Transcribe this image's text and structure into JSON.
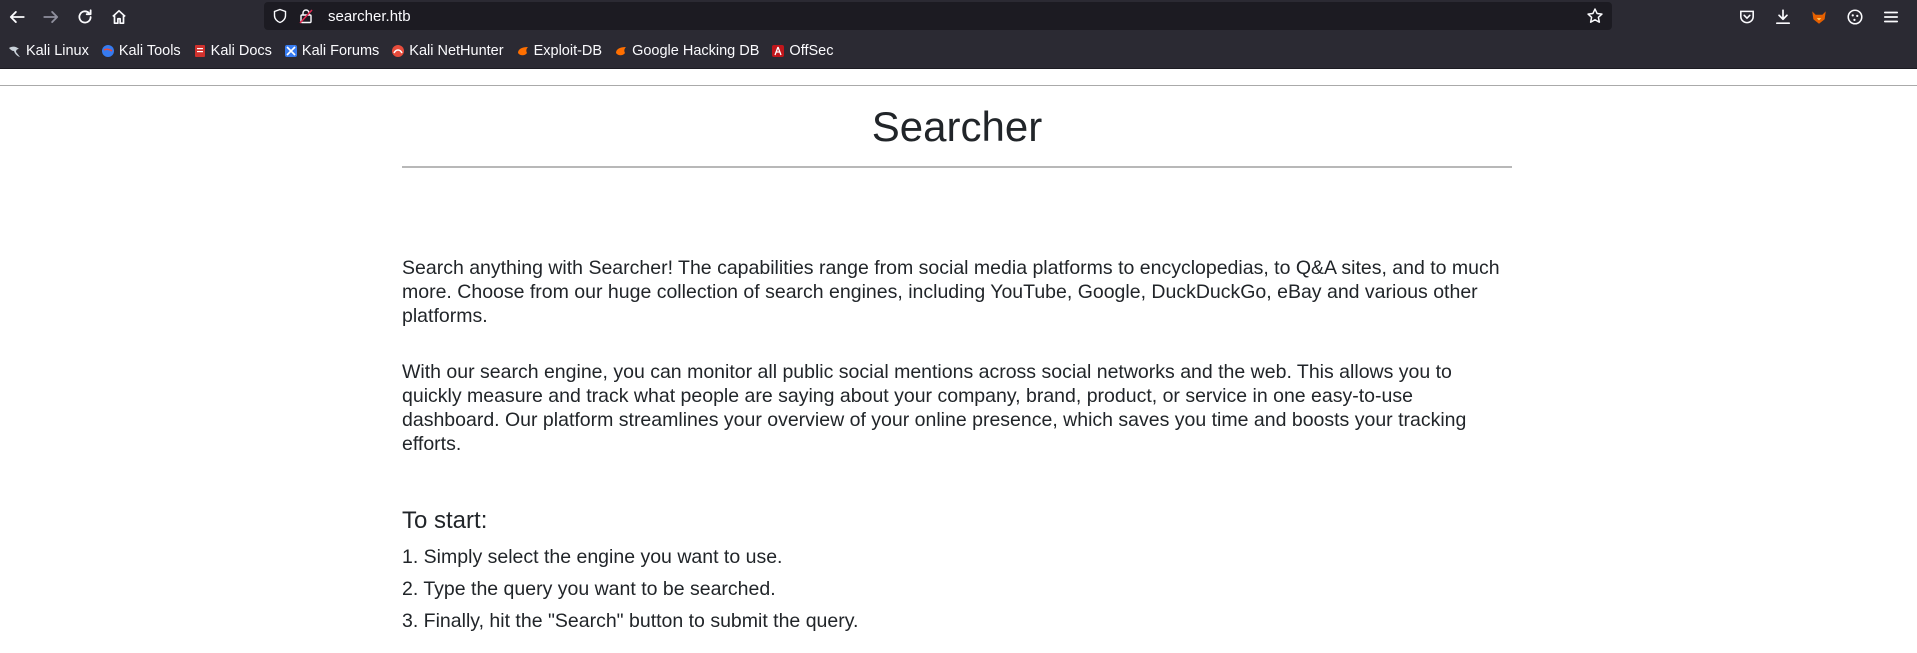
{
  "browser": {
    "url": "searcher.htb",
    "bookmarks": [
      {
        "label": "Kali Linux",
        "icon": "kali-dragon-icon"
      },
      {
        "label": "Kali Tools",
        "icon": "kali-tools-icon"
      },
      {
        "label": "Kali Docs",
        "icon": "kali-docs-icon"
      },
      {
        "label": "Kali Forums",
        "icon": "kali-forums-icon"
      },
      {
        "label": "Kali NetHunter",
        "icon": "nethunter-icon"
      },
      {
        "label": "Exploit-DB",
        "icon": "exploit-db-icon"
      },
      {
        "label": "Google Hacking DB",
        "icon": "ghdb-icon"
      },
      {
        "label": "OffSec",
        "icon": "offsec-icon"
      }
    ]
  },
  "page": {
    "title": "Searcher",
    "paragraph1": "Search anything with Searcher! The capabilities range from social media platforms to encyclopedias, to Q&A sites, and to much more. Choose from our huge collection of search engines, including YouTube, Google, DuckDuckGo, eBay and various other platforms.",
    "paragraph2": "With our search engine, you can monitor all public social mentions across social networks and the web. This allows you to quickly measure and track what people are saying about your company, brand, product, or service in one easy-to-use dashboard. Our platform streamlines your overview of your online presence, which saves you time and boosts your tracking efforts.",
    "start_heading": "To start:",
    "steps": [
      "1. Simply select the engine you want to use.",
      "2. Type the query you want to be searched.",
      "3. Finally, hit the \"Search\" button to submit the query."
    ]
  }
}
